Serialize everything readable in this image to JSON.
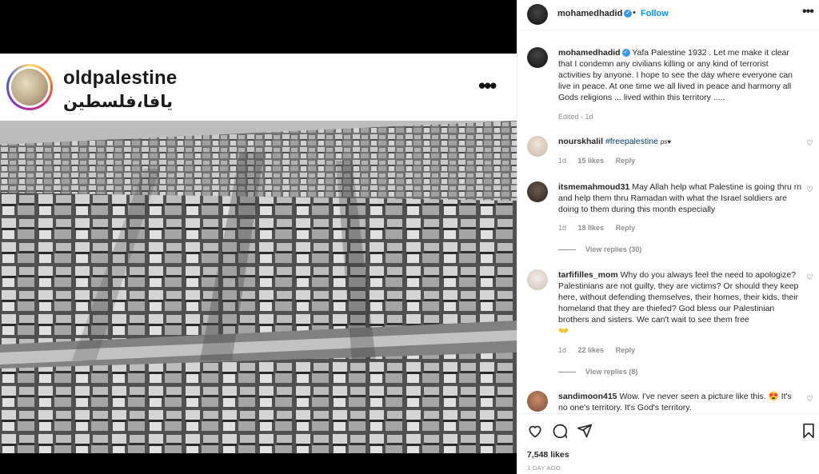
{
  "image": {
    "overlay_username": "oldpalestine",
    "overlay_arabic": "يافا،فلسطين"
  },
  "header": {
    "username": "mohamedhadid",
    "separator": "•",
    "follow_label": "Follow"
  },
  "caption": {
    "username": "mohamedhadid",
    "text": "Yafa Palestine 1932 . Let me make it clear that I condemn any civilians killing or any kind of terrorist activities by anyone. I hope to see the day where everyone can live in peace. At one time we all lived in peace and harmony all Gods religions ... lived within this territory .....",
    "meta": "Edited · 1d"
  },
  "comments": [
    {
      "username": "nourskhalil",
      "hashtag": "#freepalestine",
      "text": "ps♥",
      "age": "1d",
      "likes": "15 likes",
      "reply": "Reply"
    },
    {
      "username": "itsmemahmoud31",
      "text": "May Allah help what Palestine is going thru rn and help them thru Ramadan with what the Israel soldiers are doing to them during this month especially",
      "age": "1d",
      "likes": "18 likes",
      "reply": "Reply",
      "view_replies": "View replies (30)"
    },
    {
      "username": "tarfifilles_mom",
      "text": "Why do you always feel the need to apologize? Palestinians are not guilty, they are victims? Or should they keep here, without defending themselves, their homes, their kids, their homeland that they are thiefed? God bless our Palestinian brothers and sisters. We can't wait to see them free",
      "emoji": "👐",
      "age": "1d",
      "likes": "22 likes",
      "reply": "Reply",
      "view_replies": "View replies (8)"
    },
    {
      "username": "sandimoon415",
      "text": "Wow. I've never seen a picture like this. 😍 It's no one's territory. It's God's territory."
    }
  ],
  "footer": {
    "likes": "7,548 likes",
    "time_ago": "1 DAY AGO"
  },
  "icons": {
    "heart": "heart-icon",
    "comment": "comment-icon",
    "share": "share-icon",
    "save": "bookmark-icon",
    "more": "more-icon"
  }
}
